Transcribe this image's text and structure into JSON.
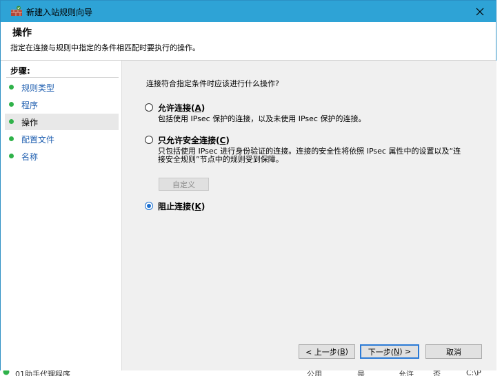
{
  "window": {
    "title": "新建入站规则向导"
  },
  "header": {
    "title": "操作",
    "description": "指定在连接与规则中指定的条件相匹配时要执行的操作。"
  },
  "sidebar": {
    "steps_label": "步骤:",
    "items": [
      {
        "label": "规则类型",
        "active": false
      },
      {
        "label": "程序",
        "active": false
      },
      {
        "label": "操作",
        "active": true
      },
      {
        "label": "配置文件",
        "active": false
      },
      {
        "label": "名称",
        "active": false
      }
    ]
  },
  "main": {
    "question": "连接符合指定条件时应该进行什么操作?",
    "options": [
      {
        "title": "允许连接",
        "accel": "A",
        "description": "包括使用 IPsec 保护的连接，以及未使用 IPsec 保护的连接。",
        "checked": false
      },
      {
        "title": "只允许安全连接",
        "accel": "C",
        "description": "只包括使用 IPsec 进行身份验证的连接。连接的安全性将依照 IPsec 属性中的设置以及“连接安全规则”节点中的规则受到保障。",
        "checked": false
      },
      {
        "title": "阻止连接",
        "accel": "K",
        "description": "",
        "checked": true
      }
    ],
    "custom_button": "自定义"
  },
  "footer": {
    "back": {
      "prefix": "< 上一步(",
      "accel": "B",
      "suffix": ")"
    },
    "next": {
      "prefix": "下一步(",
      "accel": "N",
      "suffix": ") >"
    },
    "cancel": "取消"
  },
  "background_row": [
    "01助手代理程序",
    "公用",
    "是",
    "允许",
    "否",
    "C:\\P"
  ],
  "colors": {
    "titlebar": "#2ea3d6",
    "link": "#1f5fb0",
    "step_dot": "#2fb24a",
    "radio_checked": "#1a6fd0"
  }
}
